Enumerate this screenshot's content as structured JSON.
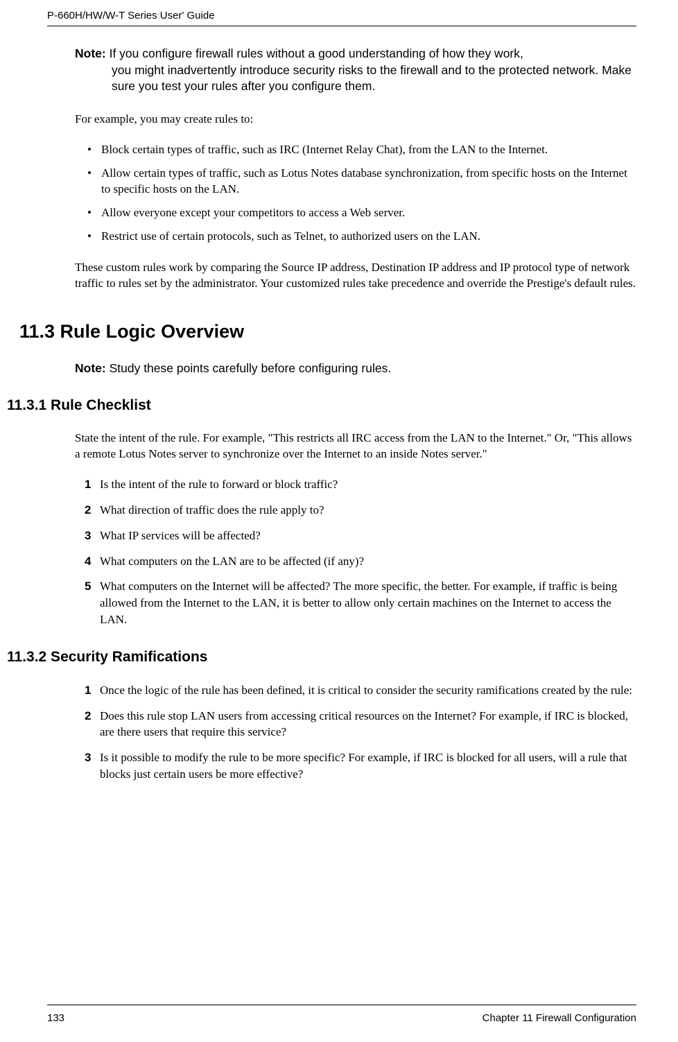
{
  "header": {
    "title": "P-660H/HW/W-T Series User' Guide"
  },
  "note1": {
    "label": "Note:",
    "text_line1": " If you configure firewall rules without a good understanding of how they work,",
    "text_line2": "you might inadvertently introduce security risks to the firewall and to the protected network. Make sure you test your rules after you configure them."
  },
  "para1": "For example, you may create rules to:",
  "bullets": [
    "Block certain types of traffic, such as IRC (Internet Relay Chat), from the LAN to the Internet.",
    "Allow certain types of traffic, such as Lotus Notes database synchronization, from specific hosts on the Internet to specific hosts on the LAN.",
    "Allow everyone except your competitors to access a Web server.",
    "Restrict use of certain protocols, such as Telnet, to authorized users on the LAN."
  ],
  "para2": "These custom rules work by comparing the Source IP address, Destination IP address and IP protocol type of network traffic to rules set by the administrator. Your customized rules take precedence and override the Prestige's default rules.",
  "section_h2": "11.3  Rule Logic Overview",
  "note2": {
    "label": "Note:",
    "text": " Study these points carefully before configuring rules."
  },
  "section_h3_1": "11.3.1  Rule Checklist",
  "para3": "State the intent of the rule. For example, \"This restricts all IRC access from the LAN to the Internet.\" Or, \"This allows a remote Lotus Notes server to synchronize over the Internet to an inside Notes server.\"",
  "numlist1": [
    "Is the intent of the rule to forward or block traffic?",
    "What direction of traffic does the rule apply to?",
    "What IP services will be affected?",
    "What computers on the LAN are to be affected (if any)?",
    "What computers on the Internet will be affected? The more specific, the better. For example, if traffic is being allowed from the Internet to the LAN, it is better to allow only certain machines on the Internet to access the LAN."
  ],
  "section_h3_2": "11.3.2  Security Ramifications",
  "numlist2": [
    "Once the logic of the rule has been defined, it is critical to consider the security ramifications created by the rule:",
    "Does this rule stop LAN users from accessing critical resources on the Internet? For example, if IRC is blocked, are there users that require this service?",
    "Is it possible to modify the rule to be more specific? For example, if IRC is blocked for all users, will a rule that blocks just certain users be more effective?"
  ],
  "footer": {
    "page": "133",
    "chapter": "Chapter 11 Firewall Configuration"
  }
}
